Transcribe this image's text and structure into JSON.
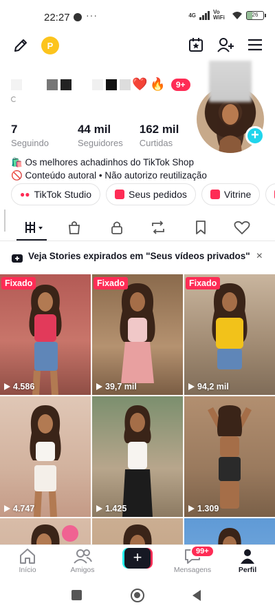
{
  "status_bar": {
    "time": "22:27",
    "more": "···",
    "network_4g": "4G",
    "vowifi": "Vo WiFi",
    "battery": "26"
  },
  "profile": {
    "heart": "❤️",
    "fire": "🔥",
    "badge": "9+",
    "stats": [
      {
        "number": "7",
        "label": "Seguindo"
      },
      {
        "number": "44 mil",
        "label": "Seguidores"
      },
      {
        "number": "162 mil",
        "label": "Curtidas"
      }
    ],
    "bio": [
      "🛍️ Os melhores achadinhos do TikTok Shop",
      "🚫 Conteúdo autoral • Não autorizo reutilização"
    ]
  },
  "chips": [
    "TikTok Studio",
    "Seus pedidos",
    "Vitrine",
    "In"
  ],
  "banner": {
    "text": "Veja Stories expirados em \"Seus vídeos privados\"",
    "close": "×"
  },
  "videos": [
    {
      "pinned": "Fixado",
      "views": "4.586",
      "bg": "#c4675d"
    },
    {
      "pinned": "Fixado",
      "views": "39,7 mil",
      "bg": "#9b7a5b"
    },
    {
      "pinned": "Fixado",
      "views": "94,2 mil",
      "bg": "#b5a08a"
    },
    {
      "pinned": "",
      "views": "4.747",
      "bg": "#d9bfae"
    },
    {
      "pinned": "",
      "views": "1.425",
      "bg": "#6b8a6a"
    },
    {
      "pinned": "",
      "views": "1.309",
      "bg": "#a48568"
    },
    {
      "pinned": "",
      "views": "",
      "bg": "#d7b9a6"
    },
    {
      "pinned": "",
      "views": "",
      "bg": "#c9a789"
    },
    {
      "pinned": "",
      "views": "",
      "bg": "#6fa5d8"
    }
  ],
  "nav": {
    "home": "Início",
    "friends": "Amigos",
    "create": "+",
    "inbox": "Mensagens",
    "inbox_badge": "99+",
    "profile": "Perfil"
  },
  "colors": {
    "accent": "#fe2c55",
    "teal": "#25f4ee",
    "follow_plus": "#20d5ec",
    "coin": "#fcc41d"
  }
}
